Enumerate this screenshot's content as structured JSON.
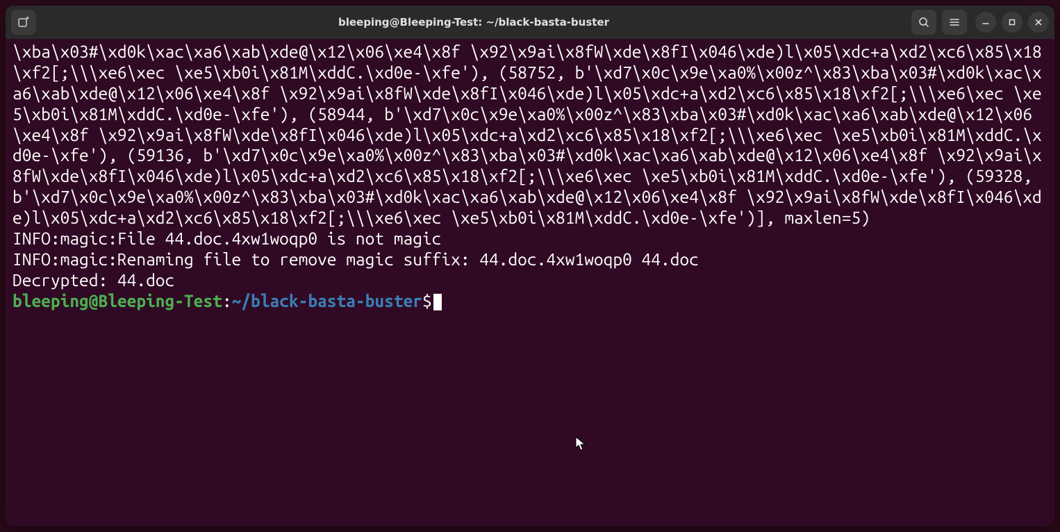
{
  "window": {
    "title": "bleeping@Bleeping-Test: ~/black-basta-buster"
  },
  "terminal": {
    "output_raw": "\\xba\\x03#\\xd0k\\xac\\xa6\\xab\\xde@\\x12\\x06\\xe4\\x8f \\x92\\x9ai\\x8fW\\xde\\x8fI\\x046\\xde)l\\x05\\xdc+a\\xd2\\xc6\\x85\\x18\\xf2[;\\\\\\xe6\\xec \\xe5\\xb0i\\x81M\\xddC.\\xd0e-\\xfe'), (58752, b'\\xd7\\x0c\\x9e\\xa0%\\x00z^\\x83\\xba\\x03#\\xd0k\\xac\\xa6\\xab\\xde@\\x12\\x06\\xe4\\x8f \\x92\\x9ai\\x8fW\\xde\\x8fI\\x046\\xde)l\\x05\\xdc+a\\xd2\\xc6\\x85\\x18\\xf2[;\\\\\\xe6\\xec \\xe5\\xb0i\\x81M\\xddC.\\xd0e-\\xfe'), (58944, b'\\xd7\\x0c\\x9e\\xa0%\\x00z^\\x83\\xba\\x03#\\xd0k\\xac\\xa6\\xab\\xde@\\x12\\x06\\xe4\\x8f \\x92\\x9ai\\x8fW\\xde\\x8fI\\x046\\xde)l\\x05\\xdc+a\\xd2\\xc6\\x85\\x18\\xf2[;\\\\\\xe6\\xec \\xe5\\xb0i\\x81M\\xddC.\\xd0e-\\xfe'), (59136, b'\\xd7\\x0c\\x9e\\xa0%\\x00z^\\x83\\xba\\x03#\\xd0k\\xac\\xa6\\xab\\xde@\\x12\\x06\\xe4\\x8f \\x92\\x9ai\\x8fW\\xde\\x8fI\\x046\\xde)l\\x05\\xdc+a\\xd2\\xc6\\x85\\x18\\xf2[;\\\\\\xe6\\xec \\xe5\\xb0i\\x81M\\xddC.\\xd0e-\\xfe'), (59328, b'\\xd7\\x0c\\x9e\\xa0%\\x00z^\\x83\\xba\\x03#\\xd0k\\xac\\xa6\\xab\\xde@\\x12\\x06\\xe4\\x8f \\x92\\x9ai\\x8fW\\xde\\x8fI\\x046\\xde)l\\x05\\xdc+a\\xd2\\xc6\\x85\\x18\\xf2[;\\\\\\xe6\\xec \\xe5\\xb0i\\x81M\\xddC.\\xd0e-\\xfe')], maxlen=5)",
    "info_line1": "INFO:magic:File 44.doc.4xw1woqp0 is not magic",
    "info_line2": "INFO:magic:Renaming file to remove magic suffix: 44.doc.4xw1woqp0 44.doc",
    "decrypted_line": "Decrypted: 44.doc",
    "prompt_user_host": "bleeping@Bleeping-Test",
    "prompt_separator": ":",
    "prompt_path": "~/black-basta-buster",
    "prompt_symbol": "$"
  }
}
